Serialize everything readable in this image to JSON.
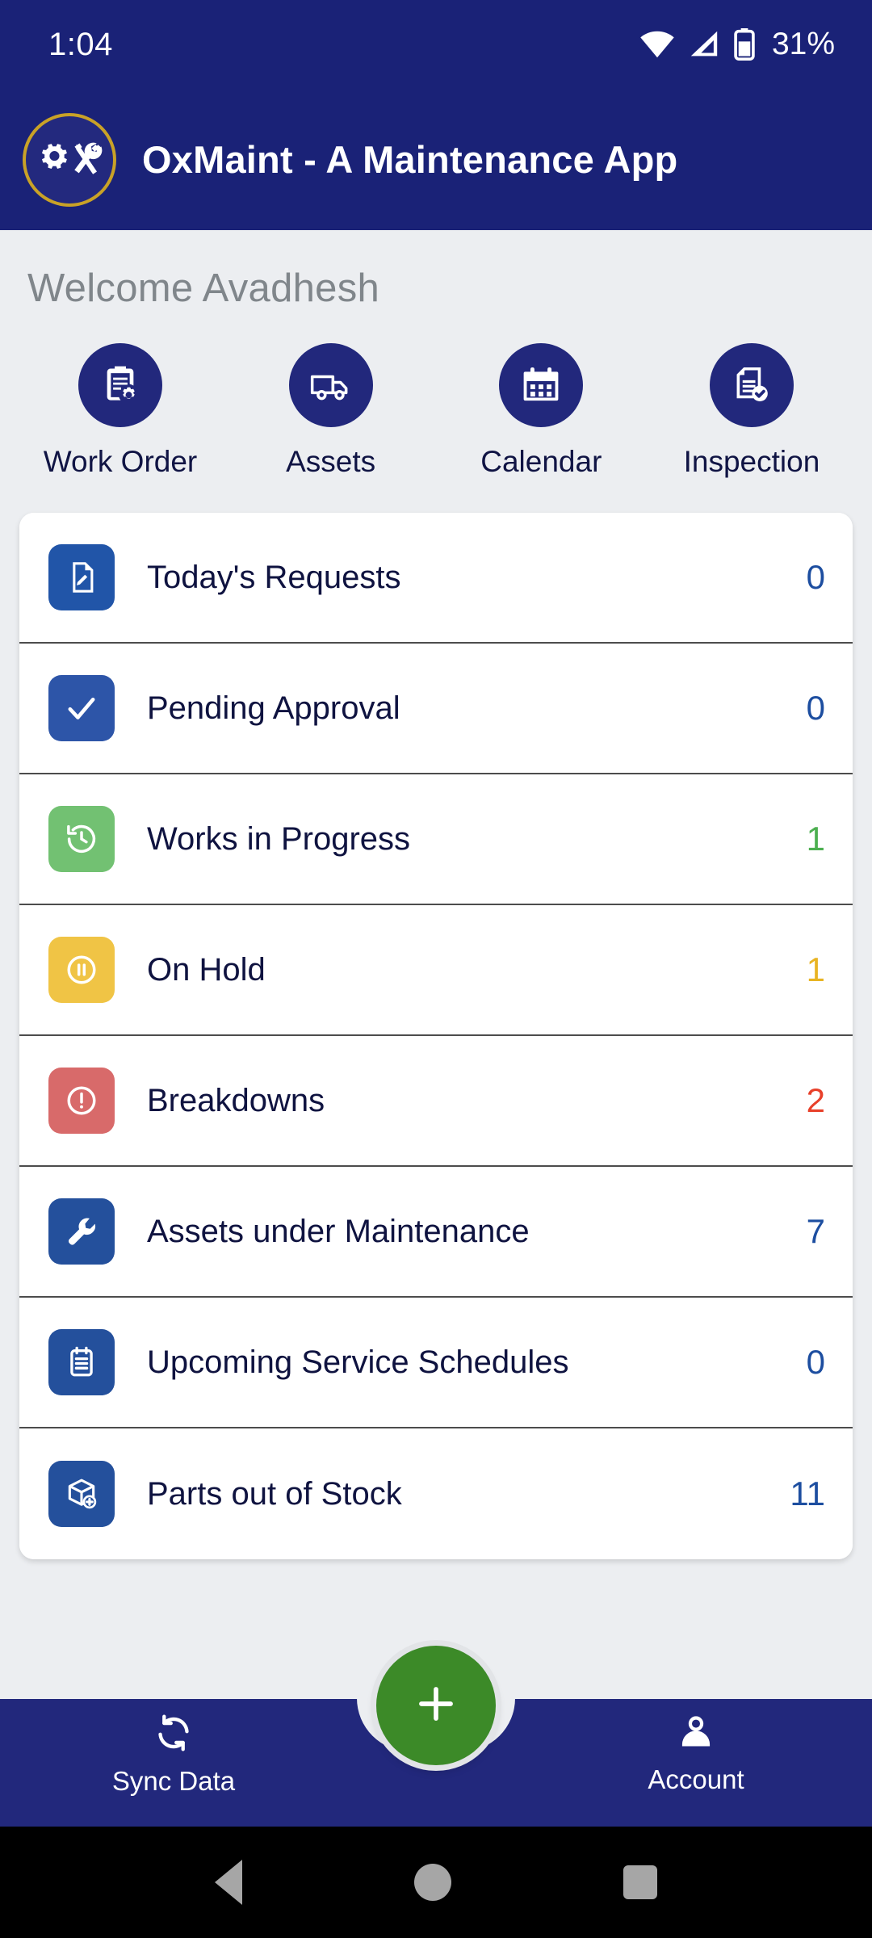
{
  "statusbar": {
    "time": "1:04",
    "battery_percent": "31%",
    "wifi_icon": "wifi-icon",
    "signal_icon": "cell-signal-icon",
    "battery_icon": "battery-icon"
  },
  "appbar": {
    "logo_icon": "gear-wrench-logo-icon",
    "title": "OxMaint - A Maintenance App"
  },
  "main": {
    "welcome": "Welcome Avadhesh",
    "quick_actions": [
      {
        "label": "Work Order",
        "icon": "clipboard-gear-icon"
      },
      {
        "label": "Assets",
        "icon": "truck-icon"
      },
      {
        "label": "Calendar",
        "icon": "calendar-icon"
      },
      {
        "label": "Inspection",
        "icon": "document-check-icon"
      }
    ],
    "stats": [
      {
        "label": "Today's Requests",
        "value": "0",
        "icon": "document-edit-icon",
        "icon_bg": "#2155a8",
        "value_color": "#1d4ea0"
      },
      {
        "label": "Pending Approval",
        "value": "0",
        "icon": "check-icon",
        "icon_bg": "#2d55a8",
        "value_color": "#1d4ea0"
      },
      {
        "label": "Works in Progress",
        "value": "1",
        "icon": "history-icon",
        "icon_bg": "#72c172",
        "value_color": "#4caf50"
      },
      {
        "label": "On Hold",
        "value": "1",
        "icon": "pause-circle-icon",
        "icon_bg": "#f0c445",
        "value_color": "#e8b423"
      },
      {
        "label": "Breakdowns",
        "value": "2",
        "icon": "alert-circle-icon",
        "icon_bg": "#d86a6a",
        "value_color": "#e8402a"
      },
      {
        "label": "Assets under Maintenance",
        "value": "7",
        "icon": "wrench-icon",
        "icon_bg": "#24509c",
        "value_color": "#1d4ea0"
      },
      {
        "label": "Upcoming Service Schedules",
        "value": "0",
        "icon": "notepad-icon",
        "icon_bg": "#24509c",
        "value_color": "#1d4ea0"
      },
      {
        "label": "Parts out of Stock",
        "value": "11",
        "icon": "box-plus-icon",
        "icon_bg": "#24509c",
        "value_color": "#1d4ea0"
      }
    ]
  },
  "bottomnav": {
    "sync_label": "Sync Data",
    "sync_icon": "sync-icon",
    "account_label": "Account",
    "account_icon": "person-icon",
    "fab_icon": "plus-icon"
  },
  "androidnav": {
    "back_icon": "back-triangle-icon",
    "home_icon": "home-circle-icon",
    "recents_icon": "recents-square-icon"
  },
  "colors": {
    "navy": "#1a2277",
    "nav_navy": "#22287c",
    "page_bg": "#eceef1",
    "fab_green": "#3c8a28",
    "logo_gold": "#c9a227"
  }
}
